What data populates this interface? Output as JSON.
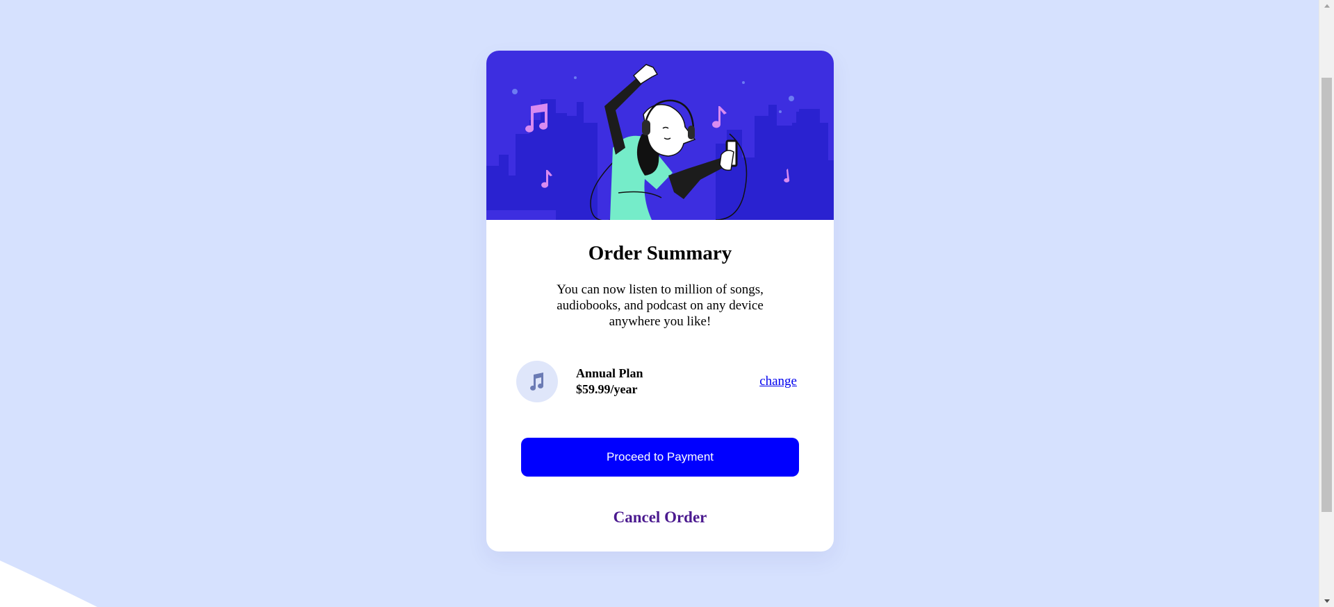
{
  "card": {
    "title": "Order Summary",
    "description": "You can now listen to million of songs, audiobooks, and podcast on any device anywhere you like!"
  },
  "plan": {
    "icon": "music-note-icon",
    "name": "Annual Plan",
    "price": "$59.99/year",
    "change_label": "change"
  },
  "actions": {
    "proceed_label": "Proceed to Payment",
    "cancel_label": "Cancel Order"
  },
  "hero": {
    "illustration": "woman-dancing-with-headphones-illustration"
  },
  "colors": {
    "page_background": "#d6e1fe",
    "hero_background": "#3d2ee0",
    "button_primary": "#0000ff",
    "cancel_text": "#4b1a8f",
    "link": "#0000ee",
    "icon_circle": "#dfe6fa"
  }
}
